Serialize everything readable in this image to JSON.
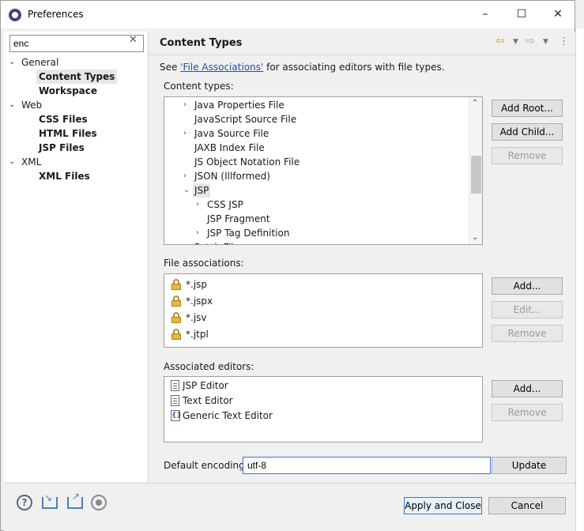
{
  "window": {
    "title": "Preferences",
    "minimize_glyph": "–",
    "maximize_glyph": "☐",
    "close_glyph": "✕"
  },
  "filter": {
    "value": "enc",
    "clear_glyph": "✕"
  },
  "tree": [
    {
      "label": "General",
      "level": 0,
      "expanded": true,
      "bold": false,
      "selected": false
    },
    {
      "label": "Content Types",
      "level": 1,
      "bold": true,
      "selected": true
    },
    {
      "label": "Workspace",
      "level": 1,
      "bold": true,
      "selected": false
    },
    {
      "label": "Web",
      "level": 0,
      "expanded": true,
      "bold": false,
      "selected": false
    },
    {
      "label": "CSS Files",
      "level": 1,
      "bold": true,
      "selected": false
    },
    {
      "label": "HTML Files",
      "level": 1,
      "bold": true,
      "selected": false
    },
    {
      "label": "JSP Files",
      "level": 1,
      "bold": true,
      "selected": false
    },
    {
      "label": "XML",
      "level": 0,
      "expanded": true,
      "bold": false,
      "selected": false
    },
    {
      "label": "XML Files",
      "level": 1,
      "bold": true,
      "selected": false
    }
  ],
  "page": {
    "title": "Content Types",
    "intro_pre": "See ",
    "intro_link": "'File Associations'",
    "intro_post": " for associating editors with file types."
  },
  "content_types": {
    "label": "Content types:",
    "items": [
      {
        "label": "Java Properties File",
        "level": 0,
        "twisty": "collapsed",
        "selected": false
      },
      {
        "label": "JavaScript Source File",
        "level": 0,
        "twisty": "none",
        "selected": false
      },
      {
        "label": "Java Source File",
        "level": 0,
        "twisty": "collapsed",
        "selected": false
      },
      {
        "label": "JAXB Index File",
        "level": 0,
        "twisty": "none",
        "selected": false
      },
      {
        "label": "JS Object Notation File",
        "level": 0,
        "twisty": "none",
        "selected": false
      },
      {
        "label": "JSON (Illformed)",
        "level": 0,
        "twisty": "collapsed",
        "selected": false
      },
      {
        "label": "JSP",
        "level": 0,
        "twisty": "expanded",
        "selected": true
      },
      {
        "label": "CSS JSP",
        "level": 1,
        "twisty": "collapsed",
        "selected": false
      },
      {
        "label": "JSP Fragment",
        "level": 1,
        "twisty": "none",
        "selected": false
      },
      {
        "label": "JSP Tag Definition",
        "level": 1,
        "twisty": "collapsed",
        "selected": false
      },
      {
        "label": "Patch File",
        "level": 0,
        "twisty": "none",
        "selected": false
      }
    ],
    "add_root": "Add Root...",
    "add_child": "Add Child...",
    "remove": "Remove"
  },
  "file_associations": {
    "label": "File associations:",
    "items": [
      "*.jsp",
      "*.jspx",
      "*.jsv",
      "*.jtpl"
    ],
    "add": "Add...",
    "edit": "Edit...",
    "remove": "Remove"
  },
  "associated_editors": {
    "label": "Associated editors:",
    "items": [
      {
        "label": "JSP Editor",
        "icon": "document-icon"
      },
      {
        "label": "Text Editor",
        "icon": "document-icon"
      },
      {
        "label": "Generic Text Editor",
        "icon": "generic-editor-icon"
      }
    ],
    "add": "Add...",
    "remove": "Remove"
  },
  "encoding": {
    "label": "Default encoding:",
    "value": "utf-8",
    "update": "Update"
  },
  "footer": {
    "help_glyph": "?",
    "apply_close": "Apply and Close",
    "cancel": "Cancel"
  },
  "colors": {
    "link": "#1a52a8",
    "lock": "#e8b93a",
    "focus": "#3a78d4"
  }
}
